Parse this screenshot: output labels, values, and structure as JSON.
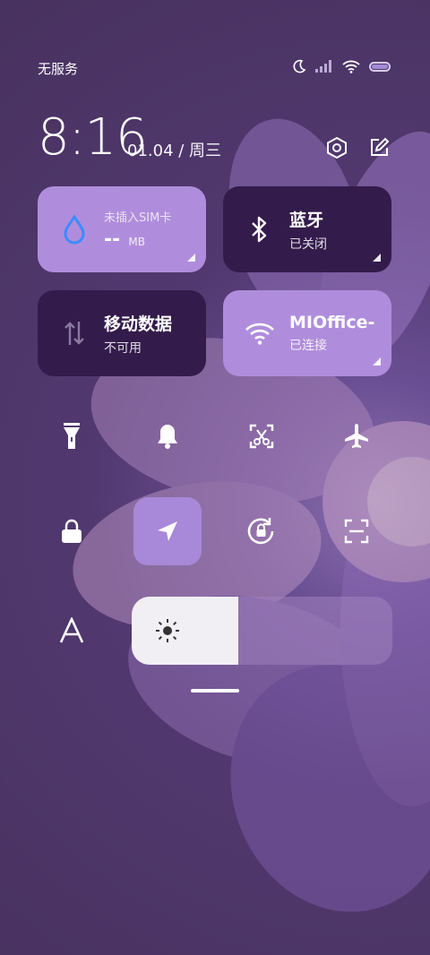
{
  "status_bar": {
    "carrier": "无服务",
    "icons": [
      "moon-icon",
      "signal-icon",
      "wifi-icon",
      "battery-icon"
    ]
  },
  "header": {
    "time": "8:16",
    "date": "01.04 / 周三",
    "icons": [
      "settings-hex-icon",
      "edit-icon"
    ]
  },
  "tiles": {
    "data_usage": {
      "label": "未插入SIM卡",
      "value": "--",
      "unit": "MB",
      "icon": "water-drop-icon",
      "accent": "#3a8cff"
    },
    "bluetooth": {
      "title": "蓝牙",
      "status": "已关闭",
      "icon": "bluetooth-icon"
    },
    "mobile_data": {
      "title": "移动数据",
      "status": "不可用",
      "icon": "data-arrows-icon"
    },
    "wifi": {
      "title": "MIOffice-",
      "status": "已连接",
      "icon": "wifi-icon"
    }
  },
  "toggles_row1": [
    "flashlight-icon",
    "bell-icon",
    "screenshot-icon",
    "airplane-icon"
  ],
  "toggles_row2": [
    "lock-icon",
    "location-icon",
    "rotation-lock-icon",
    "scan-icon"
  ],
  "location_active": true,
  "brightness": {
    "label_icon": "font-a-icon",
    "level": 0.41,
    "icon": "sun-icon"
  },
  "colors": {
    "tile_light": "#b08ddc",
    "tile_dark": "#331b4b",
    "active_toggle": "#a888d8"
  }
}
